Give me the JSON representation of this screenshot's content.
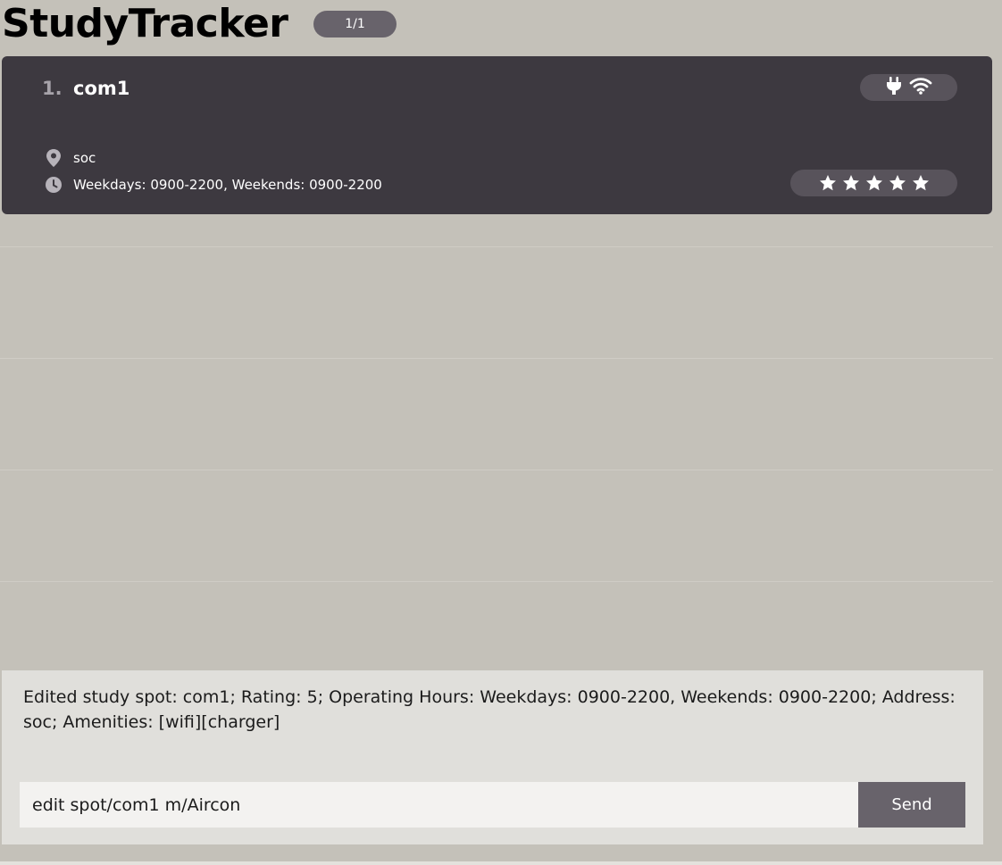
{
  "app": {
    "title": "StudyTracker",
    "page_indicator": "1/1"
  },
  "spots": [
    {
      "index": "1.",
      "name": "com1",
      "address": "soc",
      "hours": "Weekdays: 0900-2200, Weekends: 0900-2200",
      "amenity_icons": [
        "charger-icon",
        "wifi-icon"
      ],
      "rating": 5
    }
  ],
  "result": {
    "message": "Edited study spot: com1; Rating: 5; Operating Hours: Weekdays: 0900-2200, Weekends: 0900-2200; Address: soc; Amenities: [wifi][charger]"
  },
  "command": {
    "value": "edit spot/com1 m/Aircon",
    "send_label": "Send"
  },
  "colors": {
    "background": "#c4c1b9",
    "card": "#3d3940",
    "badge": "#58535b",
    "button": "#68636b",
    "result_panel": "#e0dfdb"
  }
}
